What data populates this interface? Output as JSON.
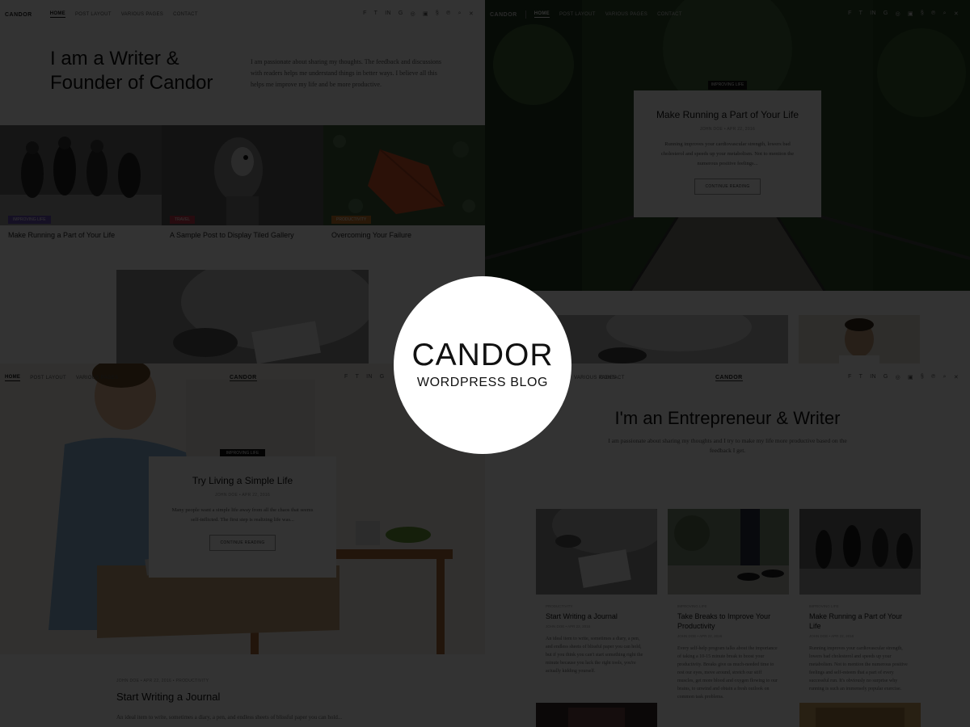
{
  "brand": {
    "logo": "CANDOR",
    "subtitle": "WORDPRESS BLOG"
  },
  "nav": {
    "items": [
      "HOME",
      "POST LAYOUT",
      "VARIOUS PAGES",
      "CONTACT"
    ]
  },
  "panel_tl": {
    "hero_title_line1": "I am a Writer &",
    "hero_title_line2": "Founder of Candor",
    "hero_text": "I am passionate about sharing my thoughts. The feedback and discussions with readers helps me understand things in better ways. I believe all this helps me improve my life and be more productive.",
    "tiles": [
      {
        "badge": "IMPROVING LIFE",
        "title": "Make Running a Part of Your Life",
        "color": "#6a4fb3"
      },
      {
        "badge": "TRAVEL",
        "title": "A Sample Post to Display Tiled Gallery",
        "color": "#c23a4a"
      },
      {
        "badge": "PRODUCTIVITY",
        "title": "Overcoming Your Failure",
        "color": "#c87a2a"
      }
    ]
  },
  "panel_tr": {
    "badge": "IMPROVING LIFE",
    "card_title": "Make Running a Part of Your Life",
    "card_meta": "JOHN DOE  •  APR 22, 2016",
    "card_excerpt": "Running improves your cardiovascular strength, lowers bad cholesterol and speeds up your metabolism. Not to mention the numerous positive feelings...",
    "card_button": "CONTINUE READING"
  },
  "panel_bl": {
    "badge": "IMPROVING LIFE",
    "card_title": "Try Living a Simple Life",
    "card_meta": "JOHN DOE  •  APR 22, 2016",
    "card_excerpt": "Many people want a simple life away from all the chaos that seems self-inflicted. The first step is realizing life was...",
    "card_button": "CONTINUE READING",
    "post_meta": "JOHN DOE  •  APR 22, 2016  •  PRODUCTIVITY",
    "post_title": "Start Writing a Journal",
    "post_excerpt": "An ideal item to write, sometimes a diary, a pen, and endless sheets of blissful paper you can hold..."
  },
  "panel_br": {
    "title": "I'm an Entrepreneur & Writer",
    "subtitle": "I am passionate about sharing my thoughts and I try to make my life more productive based on the feedback I get.",
    "posts": [
      {
        "category": "PRODUCTIVITY",
        "title": "Start Writing a Journal",
        "meta": "JOHN DOE  •  APR 22, 2016",
        "excerpt": "An ideal item to write, sometimes a diary, a pen, and endless sheets of blissful paper you can hold, but if you think you can't start something right the minute because you lack the right tools, you're actually kidding yourself."
      },
      {
        "category": "IMPROVING LIFE",
        "title": "Take Breaks to Improve Your Productivity",
        "meta": "JOHN DOE  •  APR 22, 2016",
        "excerpt": "Every self-help program talks about the importance of taking a 10-15 minute break to boost your productivity. Breaks give us much-needed time to rest our eyes, move around, stretch our stiff muscles, get more blood and oxygen flowing to our brains, to unwind and obtain a fresh outlook on common task problems."
      },
      {
        "category": "IMPROVING LIFE",
        "title": "Make Running a Part of Your Life",
        "meta": "JOHN DOE  •  APR 22, 2016",
        "excerpt": "Running improves your cardiovascular strength, lowers bad cholesterol and speeds up your metabolism. Not to mention the numerous positive feelings and self-esteem that a part of every successful run. It's obviously no surprise why running is such an immensely popular exercise."
      }
    ]
  }
}
